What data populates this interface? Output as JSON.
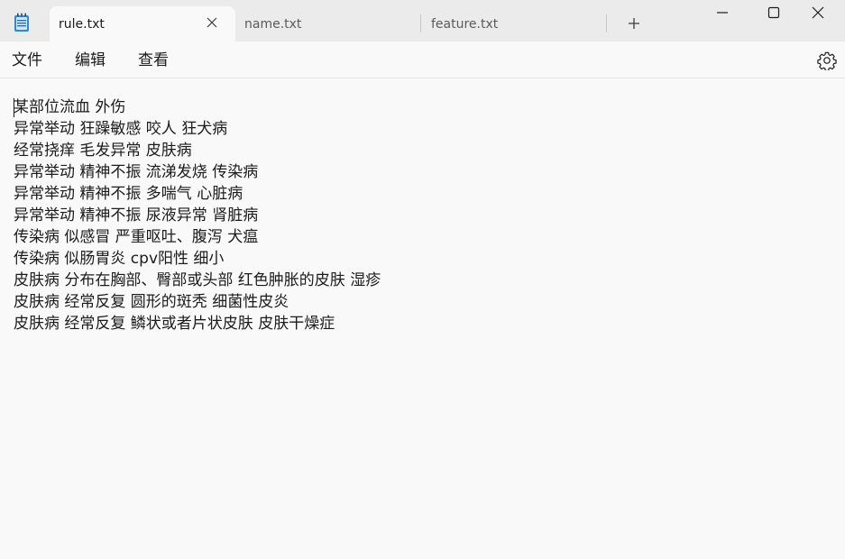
{
  "tabs": [
    {
      "label": "rule.txt",
      "active": true
    },
    {
      "label": "name.txt",
      "active": false
    },
    {
      "label": "feature.txt",
      "active": false
    }
  ],
  "icons": {
    "app": "notepad-icon",
    "close_tab": "close-icon",
    "new_tab": "plus-icon",
    "minimize": "minimize-icon",
    "maximize": "maximize-icon",
    "close_window": "close-icon",
    "settings": "gear-icon"
  },
  "menu": {
    "file": "文件",
    "edit": "编辑",
    "view": "查看"
  },
  "editor": {
    "lines": [
      "某部位流血 外伤",
      "异常举动 狂躁敏感 咬人 狂犬病",
      "经常挠痒 毛发异常 皮肤病",
      "异常举动 精神不振 流涕发烧 传染病",
      "异常举动 精神不振 多喘气 心脏病",
      "异常举动 精神不振 尿液异常 肾脏病",
      "传染病 似感冒 严重呕吐、腹泻 犬瘟",
      "传染病 似肠胃炎 cpv阳性 细小",
      "皮肤病 分布在胸部、臀部或头部 红色肿胀的皮肤 湿疹",
      "皮肤病 经常反复 圆形的斑秃 细菌性皮炎",
      "皮肤病 经常反复 鳞状或者片状皮肤 皮肤干燥症"
    ]
  },
  "colors": {
    "titlebar_bg": "#ebebeb",
    "editor_bg": "#f9f9f9",
    "text": "#1b1b1b",
    "app_icon": "#1f6fb5"
  }
}
